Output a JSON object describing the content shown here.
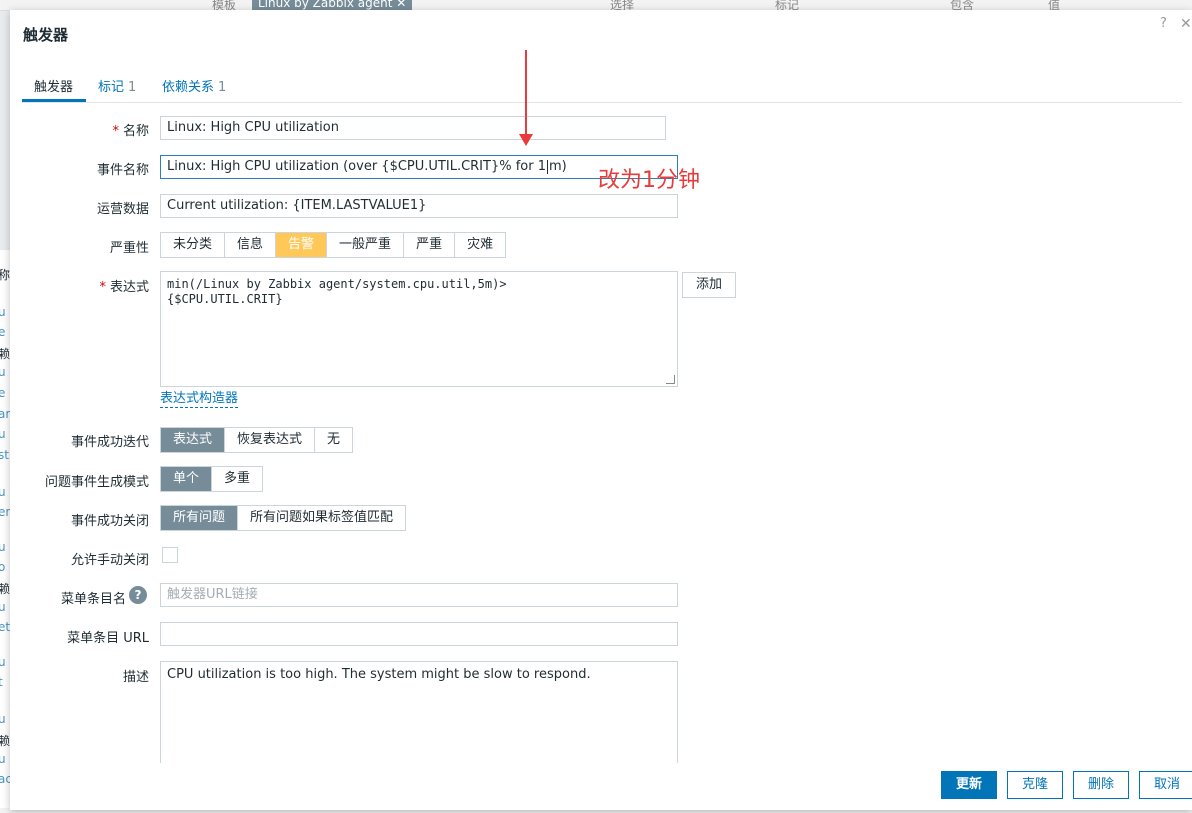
{
  "background": {
    "top_items": [
      "模板",
      "Linux by Zabbix agent ✕",
      "选择",
      "标记",
      "包含",
      "值"
    ],
    "left_fragments": [
      "称",
      "u",
      "e",
      "赖",
      "u",
      "e",
      "ar",
      "u",
      "st",
      "u",
      "er",
      "u",
      "o",
      "赖",
      "u",
      "et",
      "u",
      "t",
      "u",
      "赖",
      "u",
      "ac"
    ]
  },
  "dialog": {
    "title": "触发器",
    "help": "?",
    "close": "✕"
  },
  "tabs": [
    {
      "label": "触发器",
      "count": ""
    },
    {
      "label": "标记",
      "count": "1"
    },
    {
      "label": "依赖关系",
      "count": "1"
    }
  ],
  "form": {
    "name": {
      "label": "名称",
      "required": "*",
      "value": "Linux: High CPU utilization"
    },
    "event_name": {
      "label": "事件名称",
      "value_before": "Linux: High CPU utilization (over {$CPU.UTIL.CRIT}% for 1",
      "value_after": "m)"
    },
    "opdata": {
      "label": "运营数据",
      "value": "Current utilization: {ITEM.LASTVALUE1}"
    },
    "severity": {
      "label": "严重性",
      "options": [
        "未分类",
        "信息",
        "告警",
        "一般严重",
        "严重",
        "灾难"
      ],
      "selected": "告警"
    },
    "expression": {
      "label": "表达式",
      "required": "*",
      "value": "min(/Linux by Zabbix agent/system.cpu.util,5m)>\n{$CPU.UTIL.CRIT}",
      "add_button": "添加",
      "constructor_link": "表达式构造器"
    },
    "ok_event_generation": {
      "label": "事件成功迭代",
      "options": [
        "表达式",
        "恢复表达式",
        "无"
      ],
      "selected": "表达式"
    },
    "problem_mode": {
      "label": "问题事件生成模式",
      "options": [
        "单个",
        "多重"
      ],
      "selected": "单个"
    },
    "ok_event_closes": {
      "label": "事件成功关闭",
      "options": [
        "所有问题",
        "所有问题如果标签值匹配"
      ],
      "selected": "所有问题"
    },
    "manual_close": {
      "label": "允许手动关闭",
      "checked": false
    },
    "url_name": {
      "label": "菜单条目名",
      "placeholder": "触发器URL链接",
      "help": "?"
    },
    "url": {
      "label": "菜单条目 URL",
      "value": ""
    },
    "description": {
      "label": "描述",
      "value": "CPU utilization is too high. The system might be slow to respond."
    }
  },
  "buttons": {
    "update": "更新",
    "clone": "克隆",
    "delete": "删除",
    "cancel": "取消"
  },
  "annotation": {
    "text": "改为1分钟",
    "color": "#e83b3b"
  },
  "colors": {
    "primary": "#0275b8",
    "selected_segment": "#768d99",
    "warning": "#ffc859",
    "required": "#d40000"
  }
}
